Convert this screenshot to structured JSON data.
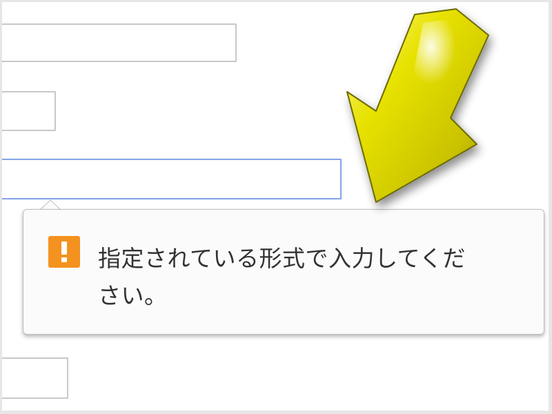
{
  "validation": {
    "message": "指定されている形式で入力してください。"
  },
  "colors": {
    "warning_icon": "#f4921f",
    "focus_border": "#86a6e8",
    "arrow_fill": "#d6d000"
  },
  "icons": {
    "warning": "exclamation-icon",
    "pointer": "arrow-icon"
  }
}
